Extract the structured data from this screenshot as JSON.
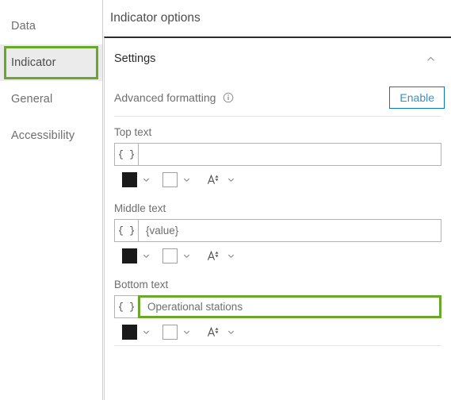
{
  "sidebar": {
    "items": [
      {
        "label": "Data",
        "selected": false,
        "highlighted": false
      },
      {
        "label": "Indicator",
        "selected": true,
        "highlighted": true
      },
      {
        "label": "General",
        "selected": false,
        "highlighted": false
      },
      {
        "label": "Accessibility",
        "selected": false,
        "highlighted": false
      }
    ]
  },
  "panel": {
    "title": "Indicator options",
    "section": {
      "title": "Settings",
      "collapse_icon": "chevron-up-icon"
    },
    "advanced": {
      "label": "Advanced formatting",
      "info_icon": "info-circle-icon",
      "button_label": "Enable"
    },
    "fields": [
      {
        "label": "Top text",
        "expression_button": "{ }",
        "value": "",
        "placeholder": "",
        "focused": false,
        "text_color_swatch": "#1a1a1a",
        "background_color_swatch": "#ffffff",
        "font_size_icon": "font-size-icon"
      },
      {
        "label": "Middle text",
        "expression_button": "{ }",
        "value": "{value}",
        "placeholder": "",
        "focused": false,
        "text_color_swatch": "#1a1a1a",
        "background_color_swatch": "#ffffff",
        "font_size_icon": "font-size-icon"
      },
      {
        "label": "Bottom text",
        "expression_button": "{ }",
        "value": "Operational stations",
        "placeholder": "",
        "focused": true,
        "text_color_swatch": "#1a1a1a",
        "background_color_swatch": "#ffffff",
        "font_size_icon": "font-size-icon"
      }
    ]
  },
  "colors": {
    "highlight_green": "#6aa82b",
    "accent_blue": "#0079c1",
    "selected_gray": "#ebebeb"
  }
}
